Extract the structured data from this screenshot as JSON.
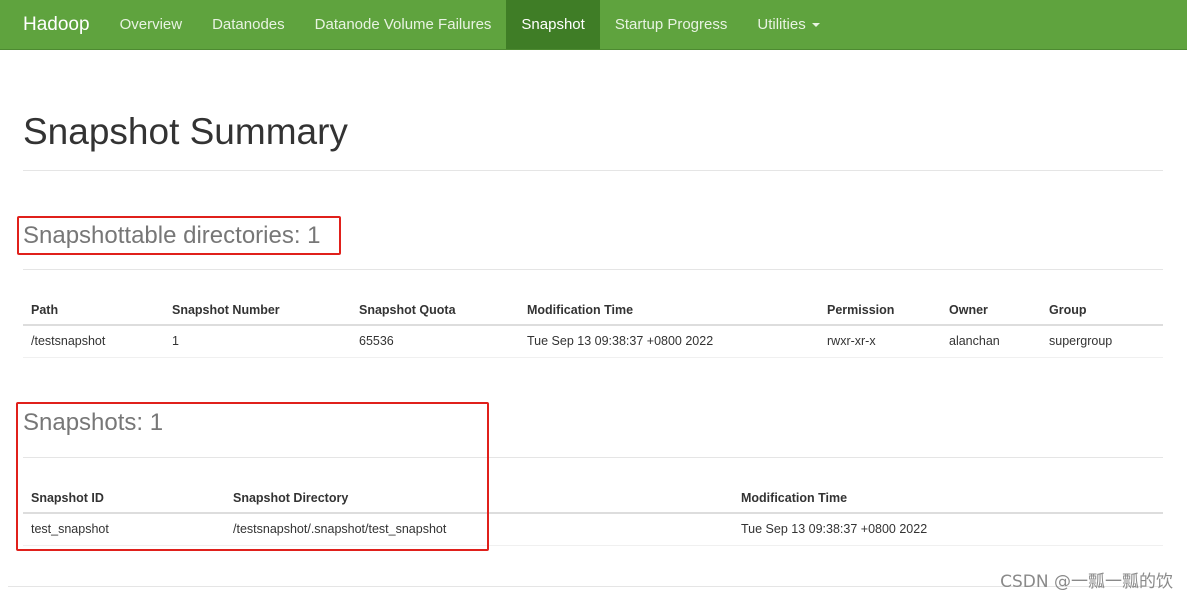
{
  "navbar": {
    "brand": "Hadoop",
    "items": [
      {
        "label": "Overview",
        "active": false
      },
      {
        "label": "Datanodes",
        "active": false
      },
      {
        "label": "Datanode Volume Failures",
        "active": false
      },
      {
        "label": "Snapshot",
        "active": true
      },
      {
        "label": "Startup Progress",
        "active": false
      },
      {
        "label": "Utilities",
        "active": false
      }
    ],
    "bg_color": "#5fa33e",
    "active_color": "#3f7d26"
  },
  "page_title": "Snapshot Summary",
  "snapshottable": {
    "title": "Snapshottable directories: 1",
    "columns": [
      "Path",
      "Snapshot Number",
      "Snapshot Quota",
      "Modification Time",
      "Permission",
      "Owner",
      "Group"
    ],
    "rows": [
      [
        "/testsnapshot",
        "1",
        "65536",
        "Tue Sep 13 09:38:37 +0800 2022",
        "rwxr-xr-x",
        "alanchan",
        "supergroup"
      ]
    ]
  },
  "snapshots": {
    "title": "Snapshots: 1",
    "columns": [
      "Snapshot ID",
      "Snapshot Directory",
      "Modification Time"
    ],
    "rows": [
      [
        "test_snapshot",
        "/testsnapshot/.snapshot/test_snapshot",
        "Tue Sep 13 09:38:37 +0800 2022"
      ]
    ]
  },
  "highlight_color": "#e0201b",
  "watermark": "CSDN @一瓢一瓢的饮"
}
